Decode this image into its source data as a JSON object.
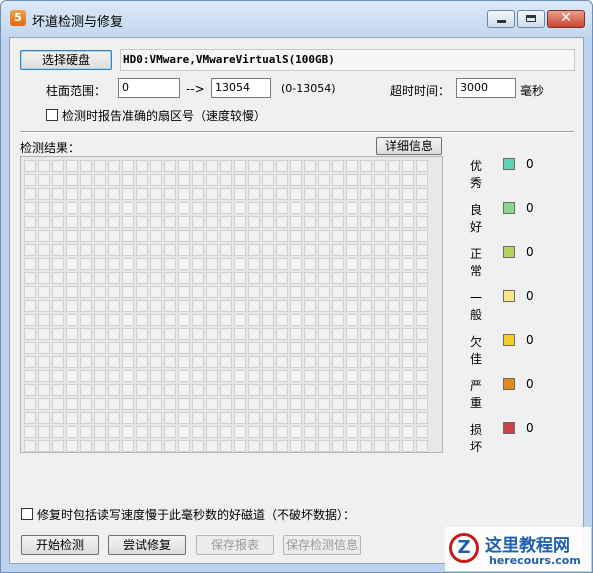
{
  "window": {
    "title": "坏道检测与修复",
    "app_icon_glyph": "5",
    "minimize_icon": "minimize-icon",
    "maximize_icon": "maximize-icon",
    "close_icon": "close-icon",
    "close_glyph": "✕"
  },
  "disk": {
    "select_button": "选择硬盘",
    "name": "HD0:VMware,VMwareVirtualS(100GB)"
  },
  "range": {
    "label": "柱面范围：",
    "from": "0",
    "arrow": "-->",
    "to": "13054",
    "hint": "(0-13054)"
  },
  "timeout": {
    "label": "超时时间：",
    "value": "3000",
    "unit": "毫秒"
  },
  "report_sector_checkbox": {
    "checked": false,
    "label": "检测时报告准确的扇区号（速度较慢）"
  },
  "results": {
    "label": "检测结果：",
    "details_button": "详细信息",
    "grid_columns": 29,
    "grid_rows": 21
  },
  "legend": [
    {
      "label": "优秀",
      "color": "#5ed2b8",
      "count": "0"
    },
    {
      "label": "良好",
      "color": "#86d78a",
      "count": "0"
    },
    {
      "label": "正常",
      "color": "#b4d35a",
      "count": "0"
    },
    {
      "label": "一般",
      "color": "#f7e68c",
      "count": "0"
    },
    {
      "label": "欠佳",
      "color": "#f5cc2b",
      "count": "0"
    },
    {
      "label": "严重",
      "color": "#e08a1e",
      "count": "0"
    },
    {
      "label": "损坏",
      "color": "#c9424a",
      "count": "0"
    }
  ],
  "repair_checkbox": {
    "checked": false,
    "label": "修复时包括读写速度慢于此毫秒数的好磁道（不破坏数据）："
  },
  "actions": {
    "start": "开始检测",
    "repair": "尝试修复",
    "save_report": "保存报表",
    "save_info": "保存检测信息"
  },
  "watermark": {
    "logo_glyph": "Z",
    "title": "这里教程网",
    "url": "herecours.com"
  }
}
